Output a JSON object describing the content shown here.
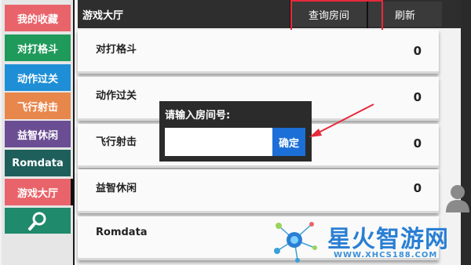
{
  "sidebar": {
    "items": [
      {
        "label": "我的收藏",
        "color": "#e8646a"
      },
      {
        "label": "对打格斗",
        "color": "#1f9a5a"
      },
      {
        "label": "动作过关",
        "color": "#1e8fd6"
      },
      {
        "label": "飞行射击",
        "color": "#e8874c"
      },
      {
        "label": "益智休闲",
        "color": "#6b4d93"
      },
      {
        "label": "Romdata",
        "color": "#1e5f5b"
      },
      {
        "label": "游戏大厅",
        "color": "#e8646a"
      }
    ],
    "search_icon": "search-icon",
    "search_color": "#1f8a6c"
  },
  "header": {
    "title": "游戏大厅",
    "query_room": "查询房间",
    "refresh": "刷新"
  },
  "list": [
    {
      "name": "对打格斗",
      "count": "0"
    },
    {
      "name": "动作过关",
      "count": "0"
    },
    {
      "name": "飞行射击",
      "count": "0"
    },
    {
      "name": "益智休闲",
      "count": "0"
    },
    {
      "name": "Romdata",
      "count": ""
    }
  ],
  "dialog": {
    "title": "请输入房间号:",
    "input_value": "",
    "confirm": "确定"
  },
  "watermark": {
    "text": "星火智游网",
    "url": "WWW.XHCS188.COM"
  }
}
